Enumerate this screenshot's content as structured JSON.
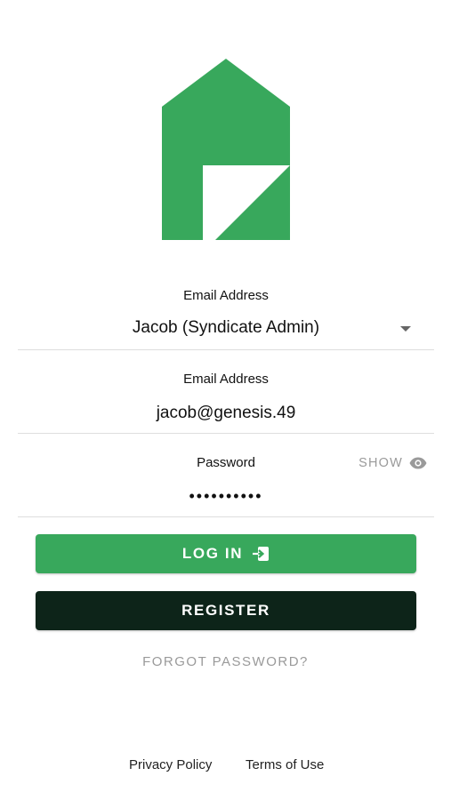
{
  "brand": {
    "color": "#38a85c",
    "icon": "house-logo-icon"
  },
  "account_field": {
    "label": "Email Address",
    "value": "Jacob (Syndicate Admin)",
    "icon": "dropdown-caret-icon"
  },
  "email_field": {
    "label": "Email Address",
    "value": "jacob@genesis.49"
  },
  "password_field": {
    "label": "Password",
    "value": "••••••••••",
    "toggle_label": "SHOW",
    "toggle_icon": "eye-icon"
  },
  "buttons": {
    "login_label": "LOG IN",
    "login_icon": "login-arrow-icon",
    "login_color": "#38a85c",
    "register_label": "REGISTER",
    "register_color": "#0d2419"
  },
  "forgot_label": "FORGOT PASSWORD?",
  "footer": {
    "privacy_label": "Privacy Policy",
    "terms_label": "Terms of Use"
  }
}
